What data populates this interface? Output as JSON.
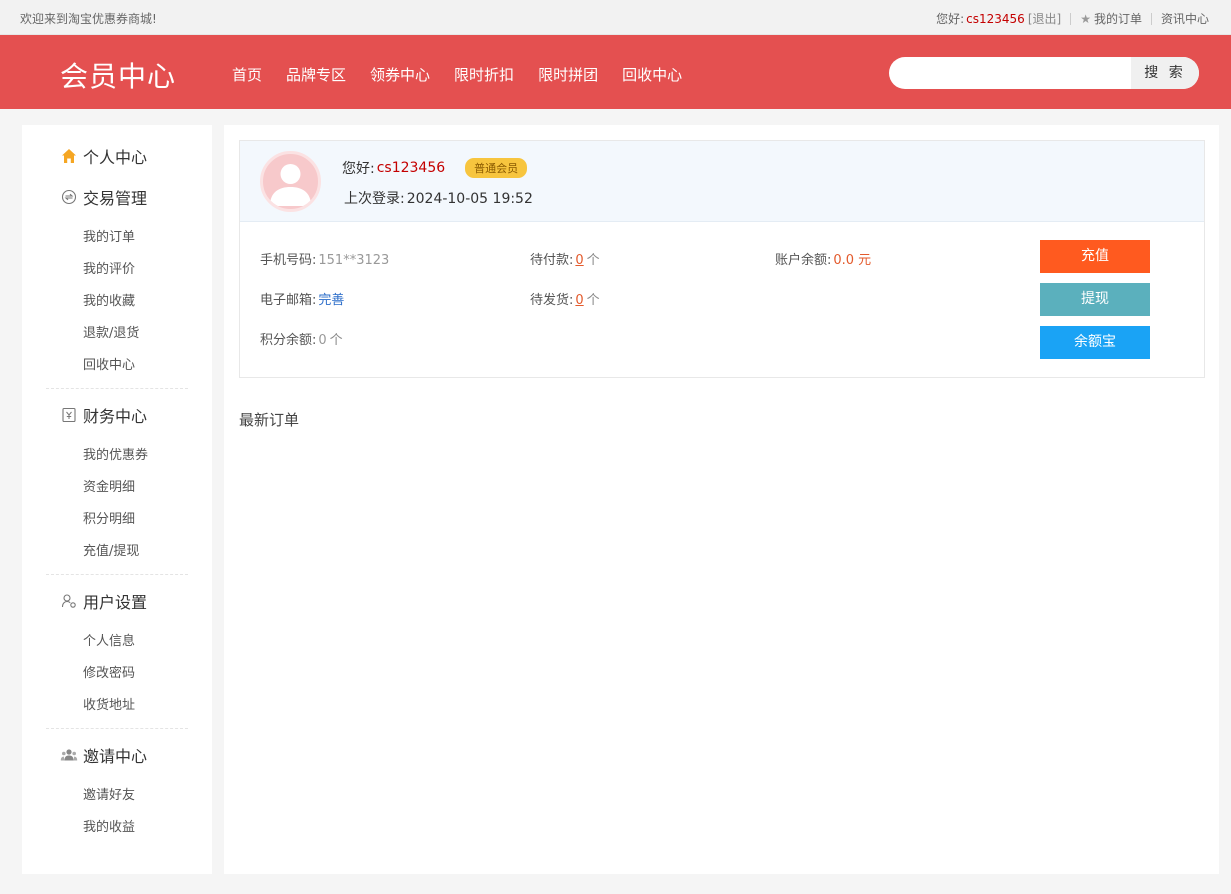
{
  "topbar": {
    "welcome": "欢迎来到淘宝优惠券商城!",
    "greeting_prefix": "您好:",
    "username": "cs123456",
    "logout": "[退出]",
    "my_orders": "我的订单",
    "news_center": "资讯中心"
  },
  "header": {
    "brand": "会员中心",
    "nav": [
      "首页",
      "品牌专区",
      "领券中心",
      "限时折扣",
      "限时拼团",
      "回收中心"
    ],
    "search_placeholder": "",
    "search_button": "搜 索"
  },
  "sidebar": {
    "personal_center": "个人中心",
    "sections": [
      {
        "title": "交易管理",
        "icon": "exchange-icon",
        "items": [
          "我的订单",
          "我的评价",
          "我的收藏",
          "退款/退货",
          "回收中心"
        ]
      },
      {
        "title": "财务中心",
        "icon": "finance-icon",
        "items": [
          "我的优惠券",
          "资金明细",
          "积分明细",
          "充值/提现"
        ]
      },
      {
        "title": "用户设置",
        "icon": "user-settings-icon",
        "items": [
          "个人信息",
          "修改密码",
          "收货地址"
        ]
      },
      {
        "title": "邀请中心",
        "icon": "invite-icon",
        "items": [
          "邀请好友",
          "我的收益"
        ]
      }
    ]
  },
  "profile": {
    "greeting": "您好:",
    "username": "cs123456",
    "level_badge": "普通会员",
    "last_login_label": "上次登录:",
    "last_login": "2024-10-05 19:52"
  },
  "account": {
    "phone_label": "手机号码:",
    "phone": "151**3123",
    "email_label": "电子邮箱:",
    "email_action": "完善",
    "points_label": "积分余额:",
    "points": "0",
    "points_unit": "个",
    "pending_pay_label": "待付款:",
    "pending_pay": "0",
    "pending_pay_unit": "个",
    "pending_ship_label": "待发货:",
    "pending_ship": "0",
    "pending_ship_unit": "个",
    "balance_label": "账户余额:",
    "balance": "0.0",
    "balance_unit": "元"
  },
  "actions": {
    "recharge": "充值",
    "withdraw": "提现",
    "yuebao": "余额宝"
  },
  "latest_orders_title": "最新订单",
  "colors": {
    "header_bg": "#e45050",
    "username": "#c40000",
    "recharge": "#ff5a1f",
    "withdraw": "#5bb0bd",
    "yuebao": "#1aa3f5",
    "badge": "#f7c53e"
  }
}
